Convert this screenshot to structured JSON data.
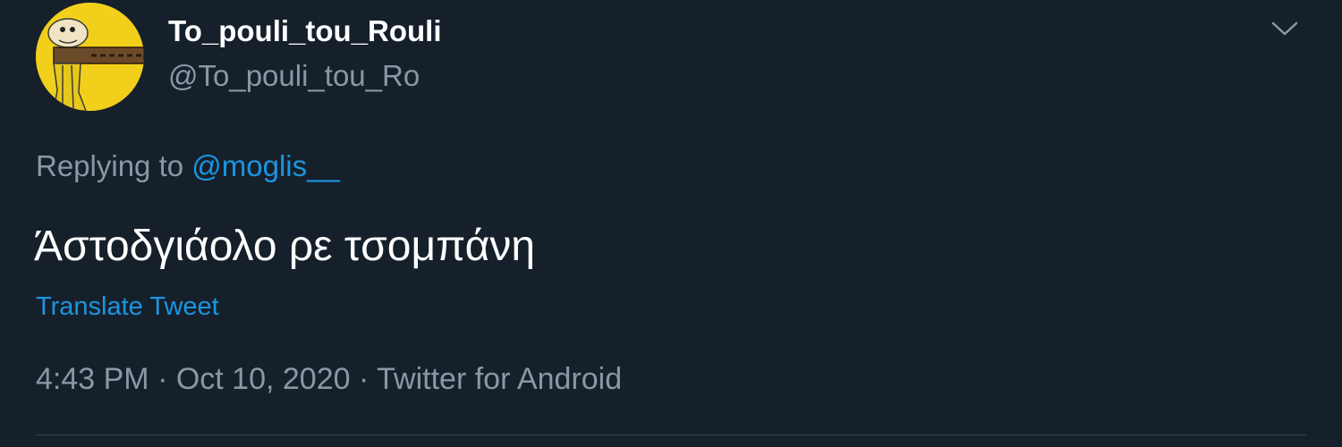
{
  "author": {
    "display_name": "To_pouli_tou_Rouli",
    "handle": "@To_pouli_tou_Ro"
  },
  "reply": {
    "prefix": "Replying to ",
    "mention": "@moglis__"
  },
  "tweet": {
    "text": "Άστοδγιάολο ρε τσομπάνη",
    "translate_label": "Translate Tweet"
  },
  "meta": {
    "time": "4:43 PM",
    "separator": " · ",
    "date": "Oct 10, 2020",
    "source": "Twitter for Android"
  },
  "icons": {
    "avatar": "avatar-yellow-cartoon",
    "more": "chevron-down-icon"
  },
  "colors": {
    "background": "#15202b",
    "primary_text": "#ffffff",
    "secondary_text": "#8899a6",
    "link": "#1b95e0",
    "divider": "#38444d"
  }
}
